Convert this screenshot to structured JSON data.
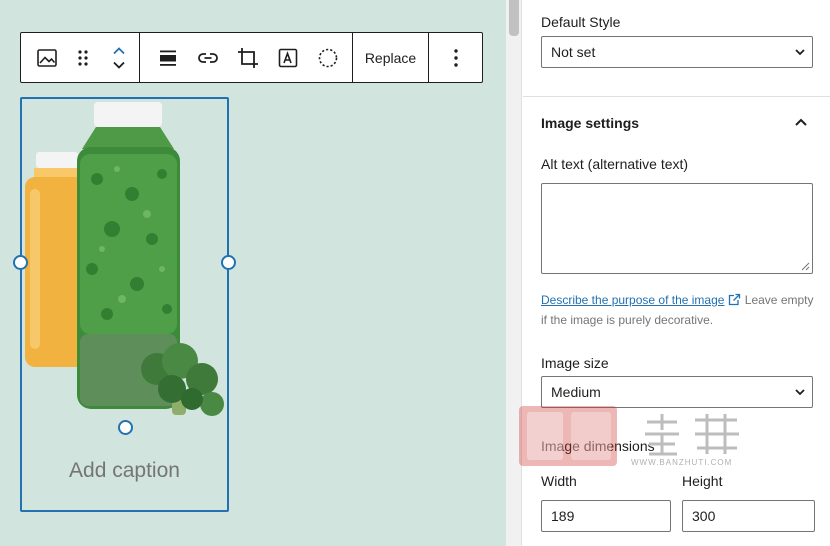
{
  "toolbar": {
    "replace_label": "Replace"
  },
  "image_block": {
    "caption_placeholder": "Add caption"
  },
  "sidebar": {
    "default_style": {
      "label": "Default Style",
      "value": "Not set"
    },
    "image_settings": {
      "title": "Image settings",
      "alt_text_label": "Alt text (alternative text)",
      "alt_text_value": "",
      "help_link": "Describe the purpose of the image",
      "help_text": " Leave empty if the image is purely decorative.",
      "image_size_label": "Image size",
      "image_size_value": "Medium",
      "dimensions_label": "Image dimensions",
      "width_label": "Width",
      "width_value": "189",
      "height_label": "Height",
      "height_value": "300"
    }
  },
  "watermark": {
    "brand": "扳手 主题",
    "url": "WWW.BANZHUTI.COM"
  },
  "colors": {
    "canvas_bg": "#d2e4de",
    "accent": "#2271b1",
    "juice_orange": "#f2b240",
    "juice_green": "#3c8a3a"
  }
}
